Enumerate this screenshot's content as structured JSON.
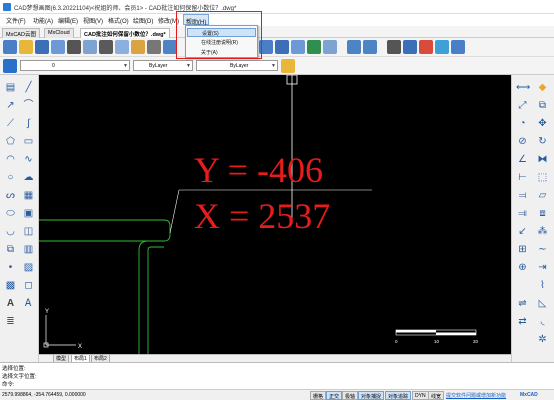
{
  "titlebar": {
    "title": "CAD梦想画图(6.3.20221104)<祝姐的师、会员1> - CAD批注如何保留小数位？.dwg*"
  },
  "menu": [
    "文件(F)",
    "功能(A)",
    "编辑(E)",
    "视图(V)",
    "格式(O)",
    "绘图(D)",
    "修改(M)",
    "帮助(H)"
  ],
  "help_menu": {
    "items": [
      "设置(S)",
      "在线注册说明(R)",
      "关于(A)"
    ],
    "selected_index": 0
  },
  "tabs": [
    "MxCAD云图",
    "MxCloud",
    "CAD批注如何保留小数位？.dwg*"
  ],
  "propbar": {
    "layer_value": "0",
    "color_value": "ByLayer",
    "linetype_value": "ByLayer"
  },
  "canvas": {
    "coord_y_text": "Y = -406",
    "coord_x_text": "X = 2537",
    "ucs_label_y": "Y",
    "ucs_label_x": "X",
    "scale_labels": [
      "0",
      "10",
      "20"
    ]
  },
  "model_tabs": [
    "模型",
    "布局1",
    "布局2"
  ],
  "command": {
    "lines": [
      "选择位置:",
      "选择文字位置:",
      "命令:"
    ]
  },
  "status": {
    "coords": "2579.998864, -354.764459, 0.000000",
    "toggles": [
      "栅格",
      "正交",
      "极轴",
      "对象捕捉",
      "对象追踪",
      "DYN",
      "线宽"
    ],
    "toggles_on": [
      1,
      3,
      4
    ],
    "feedback_link": "提交软件问题或增加新功能",
    "brand": "MxCAD"
  },
  "colors": {
    "coord_text": "#e81c1c",
    "drawing_green": "#2fbf2f",
    "highlight_box": "#e01b1b"
  }
}
